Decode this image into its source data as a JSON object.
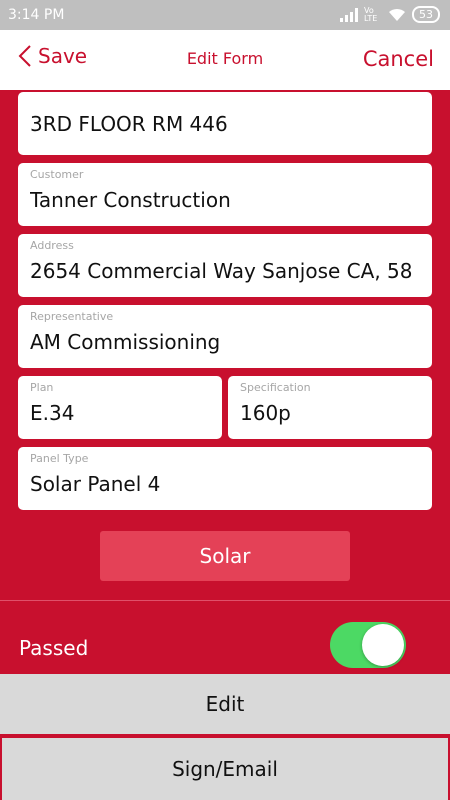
{
  "status_bar": {
    "time": "3:14 PM",
    "network": "Vo LTE",
    "battery": "53"
  },
  "nav": {
    "back_label": "Save",
    "title": "Edit Form",
    "cancel_label": "Cancel"
  },
  "form": {
    "location_value": "3RD FLOOR RM 446",
    "customer": {
      "label": "Customer",
      "value": "Tanner Construction"
    },
    "address": {
      "label": "Address",
      "value": "2654 Commercial Way Sanjose CA, 58"
    },
    "representative": {
      "label": "Representative",
      "value": "AM Commissioning"
    },
    "plan": {
      "label": "Plan",
      "value": "E.34"
    },
    "specification": {
      "label": "Specification",
      "value": "160p"
    },
    "panel_type": {
      "label": "Panel Type",
      "value": "Solar Panel 4"
    },
    "solar_button_label": "Solar"
  },
  "passed": {
    "label": "Passed",
    "toggle_on": true
  },
  "actions": {
    "edit_label": "Edit",
    "sign_email_label": "Sign/Email"
  },
  "colors": {
    "brand_red": "#c8102e",
    "solar_button": "#e44157",
    "toggle_on": "#4cd964"
  }
}
